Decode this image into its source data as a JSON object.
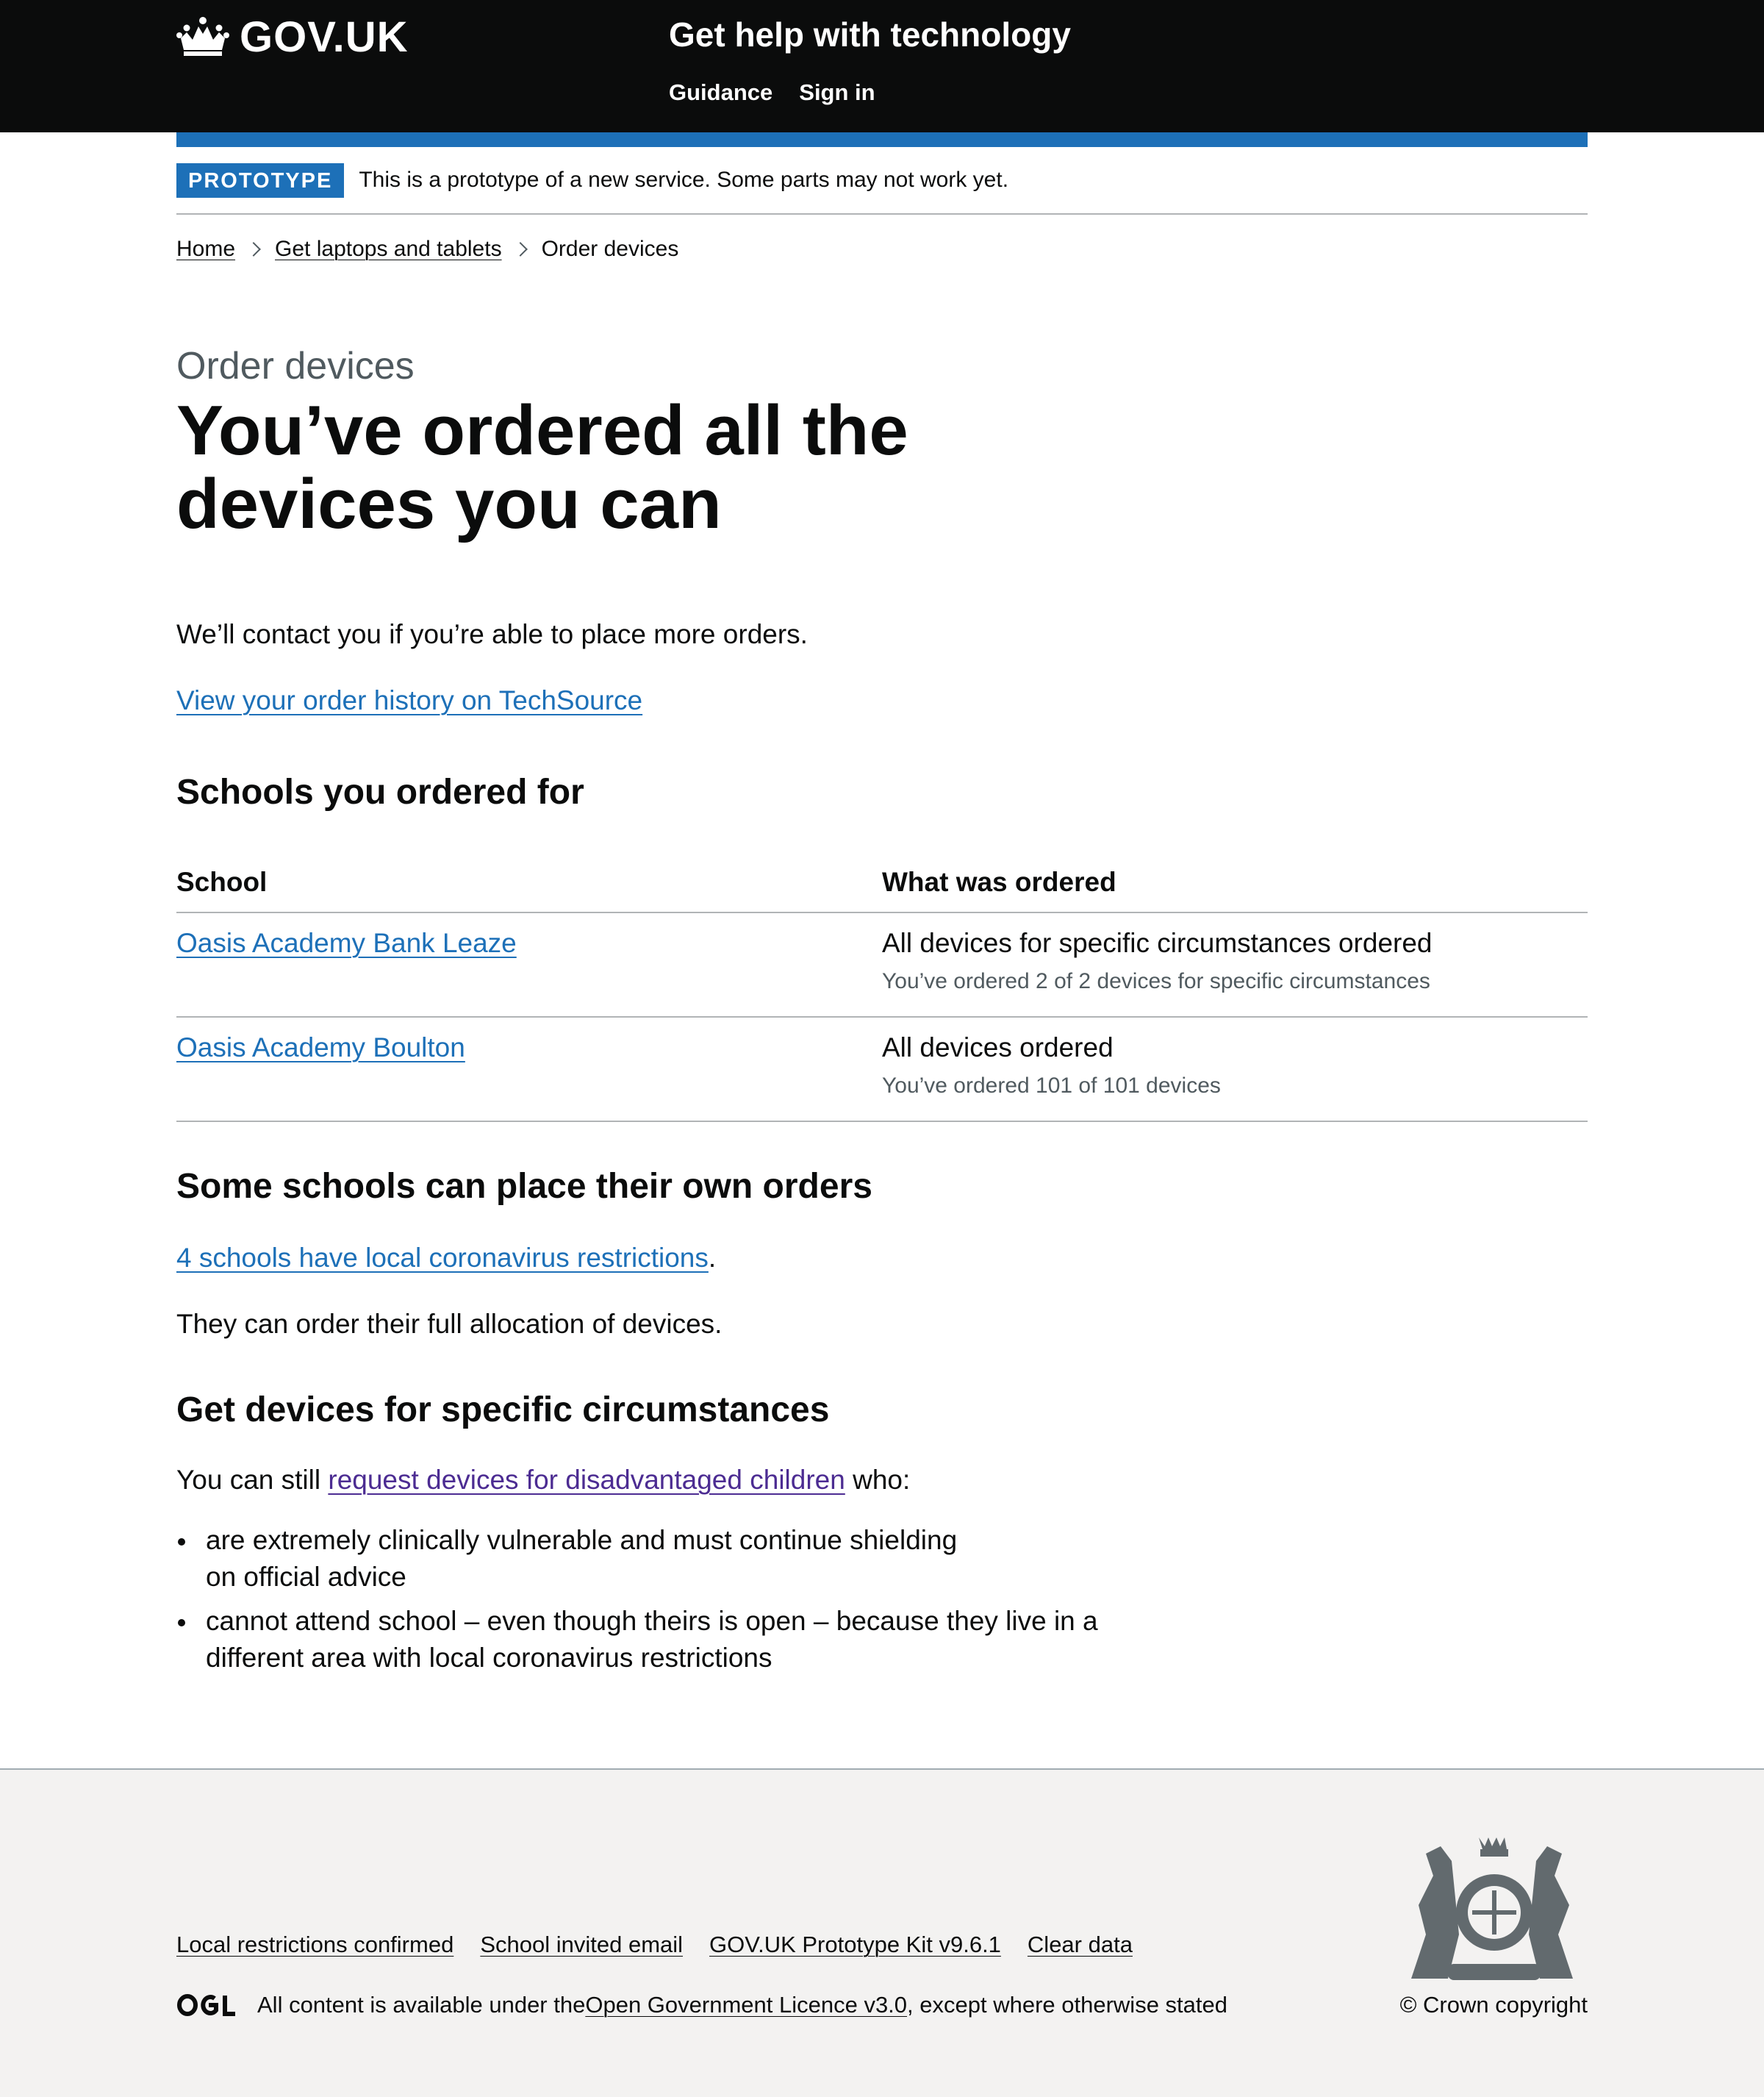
{
  "header": {
    "logo_text": "GOV.UK",
    "service_name": "Get help with technology",
    "nav": [
      "Guidance",
      "Sign in"
    ]
  },
  "phase": {
    "tag": "PROTOTYPE",
    "text": "This is a prototype of a new service. Some parts may not work yet."
  },
  "breadcrumb": [
    "Home",
    "Get laptops and tablets",
    "Order devices"
  ],
  "page": {
    "caption": "Order devices",
    "title_line1": "You’ve ordered all the",
    "title_line2": "devices you can",
    "contact_text": "We’ll contact you if you’re able to place more orders.",
    "order_history_link": "View your order history on TechSource"
  },
  "schools": {
    "heading": "Schools you ordered for",
    "columns": [
      "School",
      "What was ordered"
    ],
    "rows": [
      {
        "school": "Oasis Academy Bank Leaze",
        "status": "All devices for specific circumstances ordered",
        "detail": "You’ve ordered 2 of 2 devices for specific circumstances"
      },
      {
        "school": "Oasis Academy Boulton",
        "status": "All devices ordered",
        "detail": "You’ve ordered 101 of 101 devices"
      }
    ]
  },
  "own_orders": {
    "heading": "Some schools can place their own orders",
    "link": "4 schools have local coronavirus restrictions",
    "link_suffix": ".",
    "text": "They can order their full allocation of devices."
  },
  "specific": {
    "heading": "Get devices for specific circumstances",
    "prefix": "You can still ",
    "link": "request devices for disadvantaged children",
    "suffix": " who:",
    "items": [
      "are extremely clinically vulnerable and must continue shielding on official advice",
      "cannot attend school – even though theirs is open – because they live in a different area with local coronavirus restrictions"
    ]
  },
  "footer": {
    "links": [
      "Local restrictions confirmed",
      "School invited email",
      "GOV.UK Prototype Kit v9.6.1",
      "Clear data"
    ],
    "licence_prefix": "All content is available under the ",
    "licence_link": "Open Government Licence v3.0",
    "licence_suffix": ", except where otherwise stated",
    "copyright": "© Crown copyright"
  },
  "colors": {
    "header_bg": "#0b0c0c",
    "brand_blue": "#1d70b8",
    "link": "#1d70b8",
    "visited_link": "#4c2c92",
    "footer_bg": "#f3f2f1"
  },
  "icons": [
    "crown-icon",
    "chevron-right-icon",
    "ogl-logo-icon",
    "royal-crest-icon"
  ]
}
